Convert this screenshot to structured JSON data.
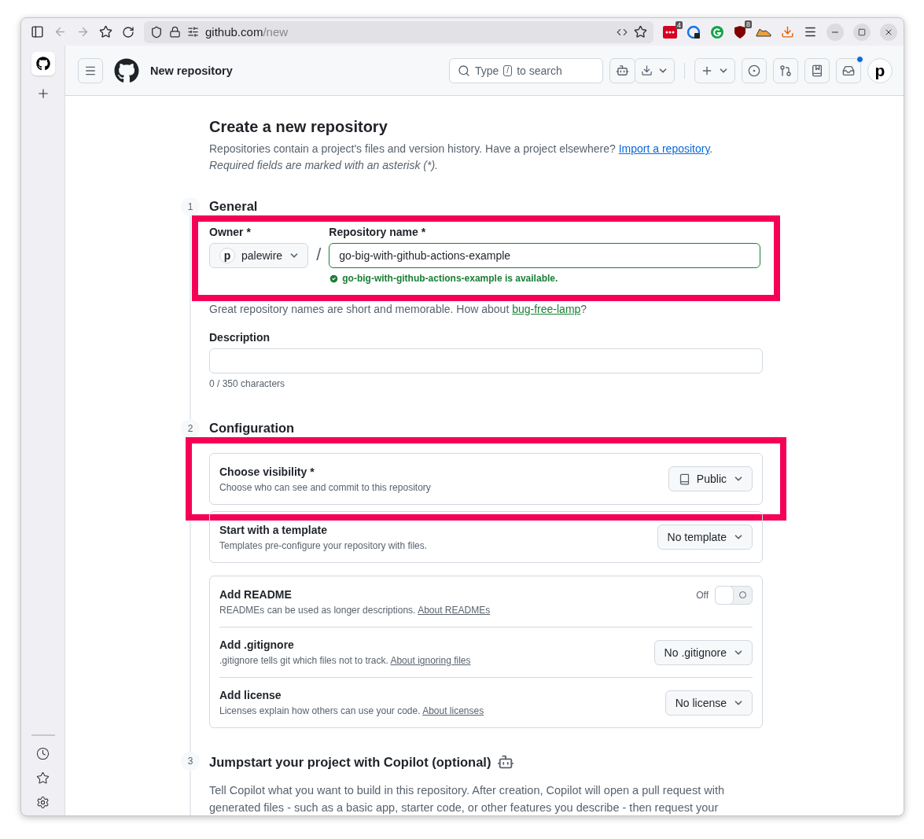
{
  "browser": {
    "url_host": "github.com",
    "url_path": "/new",
    "extensions": [
      {
        "kind": "dots",
        "badge": "4"
      },
      {
        "kind": "ring"
      },
      {
        "kind": "letter-g"
      },
      {
        "kind": "shield",
        "badge": "8"
      },
      {
        "kind": "shoe"
      },
      {
        "kind": "download"
      }
    ]
  },
  "header": {
    "title": "New repository",
    "search_before": "Type",
    "search_key": "/",
    "search_after": "to search",
    "avatar": "p",
    "unread": true
  },
  "page": {
    "title": "Create a new repository",
    "intro": "Repositories contain a project's files and version history. Have a project elsewhere? ",
    "intro_link": "Import a repository",
    "intro_end": ".",
    "note": "Required fields are marked with an asterisk (*)."
  },
  "general": {
    "step": "1",
    "title": "General",
    "highlighted": true,
    "owner_label": "Owner *",
    "owner_avatar": "p",
    "owner": "palewire",
    "separator": "/",
    "name_label": "Repository name *",
    "name_value": "go-big-with-github-actions-example",
    "status": "go-big-with-github-actions-example is available.",
    "suggestion": "Great repository names are short and memorable. How about ",
    "suggestion_link": "bug-free-lamp",
    "suggestion_end": "?",
    "description_label": "Description",
    "counter": "0 / 350 characters"
  },
  "configuration": {
    "step": "2",
    "title": "Configuration",
    "cards": [
      {
        "highlighted": true,
        "rows": [
          {
            "kind": "dropdown",
            "title": "Choose visibility *",
            "text": "Choose who can see and commit to this repository",
            "value": "Public",
            "repo_icon": true
          }
        ]
      },
      {
        "highlighted": false,
        "rows": [
          {
            "kind": "dropdown",
            "title": "Start with a template",
            "text": "Templates pre-configure your repository with files.",
            "value": "No template",
            "repo_icon": false
          }
        ]
      },
      {
        "highlighted": false,
        "rows": [
          {
            "kind": "toggle",
            "title": "Add README",
            "text": "READMEs can be used as longer descriptions. ",
            "link": "About READMEs",
            "state_label": "Off",
            "on": false
          },
          {
            "kind": "dropdown",
            "title": "Add .gitignore",
            "text": ".gitignore tells git which files not to track. ",
            "link": "About ignoring files",
            "value": "No .gitignore",
            "repo_icon": false
          },
          {
            "kind": "dropdown",
            "title": "Add license",
            "text": "Licenses explain how others can use your code. ",
            "link": "About licenses",
            "value": "No license",
            "repo_icon": false
          }
        ]
      }
    ]
  },
  "copilot": {
    "step": "3",
    "title": "Jumpstart your project with Copilot (optional)",
    "lines": [
      "Tell Copilot what you want to build in this repository. After creation, Copilot will open a pull request with",
      "generated files - such as a basic app, starter code, or other features you describe - then request your"
    ]
  }
}
